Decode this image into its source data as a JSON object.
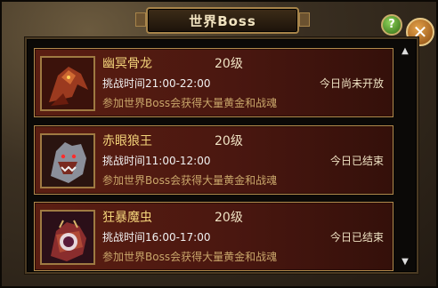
{
  "window": {
    "title": "世界Boss"
  },
  "controls": {
    "help": "?",
    "close": "✕"
  },
  "bosses": [
    {
      "name": "幽冥骨龙",
      "level": "20级",
      "time": "挑战时间21:00-22:00",
      "desc": "参加世界Boss会获得大量黄金和战魂",
      "status": "今日尚未开放",
      "icon": "bone-dragon-portrait"
    },
    {
      "name": "赤眼狼王",
      "level": "20级",
      "time": "挑战时间11:00-12:00",
      "desc": "参加世界Boss会获得大量黄金和战魂",
      "status": "今日已结束",
      "icon": "wolf-king-portrait"
    },
    {
      "name": "狂暴魔虫",
      "level": "20级",
      "time": "挑战时间16:00-17:00",
      "desc": "参加世界Boss会获得大量黄金和战魂",
      "status": "今日已结束",
      "icon": "demon-bug-portrait"
    }
  ],
  "scroll": {
    "up": "▲",
    "down": "▼"
  },
  "colors": {
    "row_bg": "#4a1710",
    "name": "#f3d37a",
    "border": "#b28a4c"
  }
}
